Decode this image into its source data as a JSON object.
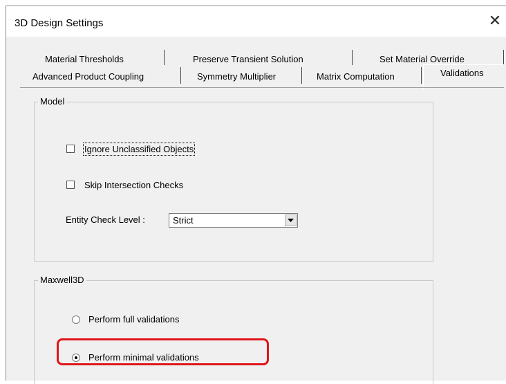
{
  "window": {
    "title": "3D Design Settings",
    "close_symbol": "✕"
  },
  "tabs": {
    "row1": [
      "Material Thresholds",
      "Preserve Transient Solution",
      "Set Material Override"
    ],
    "row2": [
      "Advanced Product Coupling",
      "Symmetry Multiplier",
      "Matrix Computation",
      "Validations"
    ],
    "active": "Validations"
  },
  "model_group": {
    "title": "Model",
    "ignore_unclassified": {
      "label": "Ignore Unclassified Objects",
      "checked": false
    },
    "skip_intersection": {
      "label": "Skip Intersection Checks",
      "checked": false
    },
    "entity_check": {
      "label": "Entity Check Level :",
      "value": "Strict"
    }
  },
  "maxwell_group": {
    "title": "Maxwell3D",
    "full_validations": {
      "label": "Perform full validations",
      "selected": false
    },
    "minimal_validations": {
      "label": "Perform minimal validations",
      "selected": true
    }
  },
  "colors": {
    "highlight": "#e0151a",
    "dialog_bg": "#f0f0f0"
  }
}
